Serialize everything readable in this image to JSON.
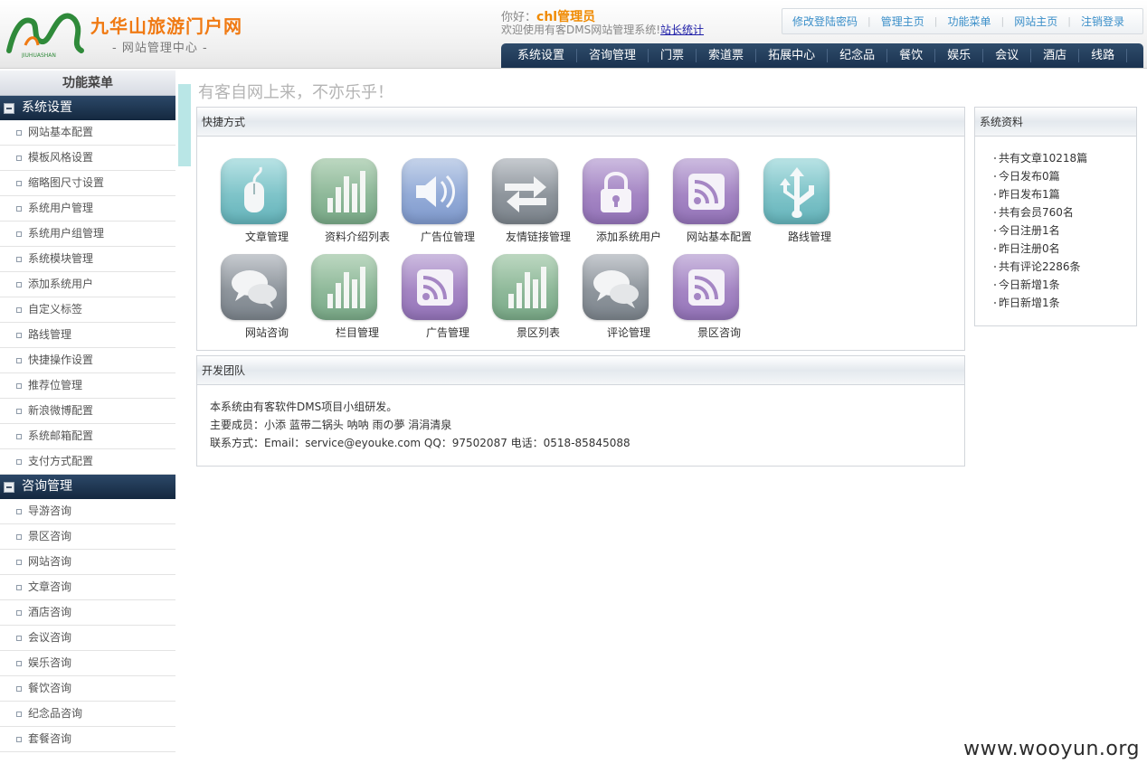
{
  "header": {
    "site_name": "九华山旅游门户网",
    "site_sub": "- 网站管理中心 -",
    "greeting_prefix": "你好：",
    "username": "chl管理员",
    "welcome_text": "欢迎使用有客DMS网站管理系统!",
    "stats_link": "站长统计",
    "top_links": [
      "修改登陆密码",
      "管理主页",
      "功能菜单",
      "网站主页",
      "注销登录"
    ],
    "nav": [
      "系统设置",
      "咨询管理",
      "门票",
      "索道票",
      "拓展中心",
      "纪念品",
      "餐饮",
      "娱乐",
      "会议",
      "酒店",
      "线路"
    ]
  },
  "sidebar": {
    "title": "功能菜单",
    "categories": [
      {
        "label": "系统设置",
        "items": [
          "网站基本配置",
          "模板风格设置",
          "缩略图尺寸设置",
          "系统用户管理",
          "系统用户组管理",
          "系统模块管理",
          "添加系统用户",
          "自定义标签",
          "路线管理",
          "快捷操作设置",
          "推荐位管理",
          "新浪微博配置",
          "系统邮箱配置",
          "支付方式配置"
        ]
      },
      {
        "label": "咨询管理",
        "items": [
          "导游咨询",
          "景区咨询",
          "网站咨询",
          "文章咨询",
          "酒店咨询",
          "会议咨询",
          "娱乐咨询",
          "餐饮咨询",
          "纪念品咨询",
          "套餐咨询"
        ]
      }
    ]
  },
  "main": {
    "slogan": "有客自网上来，不亦乐乎！",
    "shortcuts": {
      "title": "快捷方式",
      "tiles": [
        {
          "label": "文章管理",
          "icon": "mouse-icon",
          "color": "teal"
        },
        {
          "label": "资料介绍列表",
          "icon": "bar-chart-icon",
          "color": "green"
        },
        {
          "label": "广告位管理",
          "icon": "speaker-icon",
          "color": "blue"
        },
        {
          "label": "友情链接管理",
          "icon": "swap-arrows-icon",
          "color": "gray"
        },
        {
          "label": "添加系统用户",
          "icon": "lock-icon",
          "color": "purple"
        },
        {
          "label": "网站基本配置",
          "icon": "rss-icon",
          "color": "purple"
        },
        {
          "label": "路线管理",
          "icon": "usb-icon",
          "color": "teal"
        },
        {
          "label": "网站咨询",
          "icon": "chat-icon",
          "color": "gray"
        },
        {
          "label": "栏目管理",
          "icon": "bar-chart-icon",
          "color": "green"
        },
        {
          "label": "广告管理",
          "icon": "rss-icon",
          "color": "purple"
        },
        {
          "label": "景区列表",
          "icon": "bar-chart-icon",
          "color": "green"
        },
        {
          "label": "评论管理",
          "icon": "chat-icon",
          "color": "gray"
        },
        {
          "label": "景区咨询",
          "icon": "rss-icon",
          "color": "purple"
        }
      ]
    },
    "team": {
      "title": "开发团队",
      "line1": "本系统由有客软件DMS项目小组研发。",
      "line2": "主要成员：小添 蓝带二锅头 呐呐 雨の夢 涓涓清泉",
      "line3": "联系方式：Email：service@eyouke.com QQ：97502087 电话：0518-85845088"
    },
    "system_info": {
      "title": "系统资料",
      "rows": [
        "共有文章10218篇",
        "今日发布0篇",
        "昨日发布1篇",
        "共有会员760名",
        "今日注册1名",
        "昨日注册0名",
        "共有评论2286条",
        "今日新增1条",
        "昨日新增1条"
      ]
    }
  },
  "watermark": "www.wooyun.org",
  "colors": {
    "nav_bg": "#1a3250",
    "accent_orange": "#f07a13",
    "link_blue": "#3b8fc9"
  }
}
